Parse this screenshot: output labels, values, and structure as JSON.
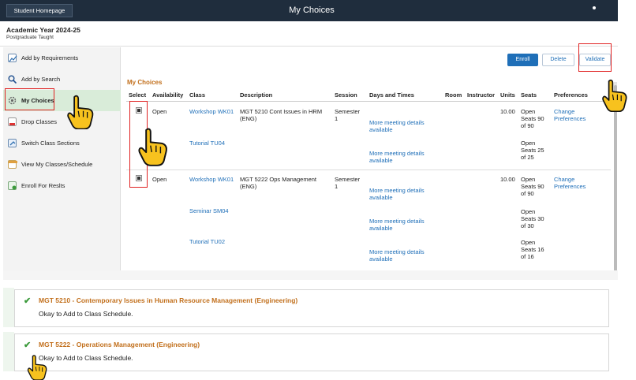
{
  "header": {
    "home_button": "Student Homepage",
    "title": "My Choices"
  },
  "context": {
    "academic_year": "Academic Year 2024-25",
    "career": "Postgraduate Taught"
  },
  "sidebar": {
    "items": [
      {
        "label": "Add by Requirements",
        "icon": "chart-icon"
      },
      {
        "label": "Add by Search",
        "icon": "search-icon"
      },
      {
        "label": "My Choices",
        "icon": "gear-icon"
      },
      {
        "label": "Drop Classes",
        "icon": "drop-icon"
      },
      {
        "label": "Switch Class Sections",
        "icon": "switch-icon"
      },
      {
        "label": "View My Classes/Schedule",
        "icon": "calendar-icon"
      },
      {
        "label": "Enroll For Reslts",
        "icon": "enroll-icon"
      }
    ]
  },
  "toolbar": {
    "enroll": "Enroll",
    "delete": "Delete",
    "validate": "Validate"
  },
  "table": {
    "title": "My Choices",
    "columns": [
      "Select",
      "Availability",
      "Class",
      "Description",
      "Session",
      "Days and Times",
      "Room",
      "Instructor",
      "Units",
      "Seats",
      "Preferences"
    ],
    "rows": [
      {
        "availability": "Open",
        "description": "MGT 5210 Cont Issues in HRM (ENG)",
        "session": "Semester 1",
        "units": "10.00",
        "preferences": "Change Preferences",
        "classes": [
          {
            "name": "Workshop WK01",
            "days": "More meeting details available",
            "seats": "Open Seats 90 of 90"
          },
          {
            "name": "Tutorial TU04",
            "days": "More meeting details available",
            "seats": "Open Seats 25 of 25"
          }
        ]
      },
      {
        "availability": "Open",
        "description": "MGT 5222 Ops Management (ENG)",
        "session": "Semester 1",
        "units": "10.00",
        "preferences": "Change Preferences",
        "classes": [
          {
            "name": "Workshop WK01",
            "days": "More meeting details available",
            "seats": "Open Seats 90 of 90"
          },
          {
            "name": "Seminar SM04",
            "days": "More meeting details available",
            "seats": "Open Seats 30 of 30"
          },
          {
            "name": "Tutorial TU02",
            "days": "More meeting details available",
            "seats": "Open Seats 16 of 16"
          }
        ]
      }
    ]
  },
  "messages": [
    {
      "title": "MGT 5210 - Contemporary Issues in Human Resource Management (Engineering)",
      "text": "Okay to Add to Class Schedule."
    },
    {
      "title": "MGT 5222 - Operations Management (Engineering)",
      "text": "Okay to Add to Class Schedule."
    }
  ],
  "colors": {
    "header_bg": "#1f2d3d",
    "accent_link": "#1f6fb8",
    "section_title": "#c2701d",
    "highlight": "#e02222",
    "success": "#3a9a3a",
    "active_nav": "#d9ecd9"
  }
}
